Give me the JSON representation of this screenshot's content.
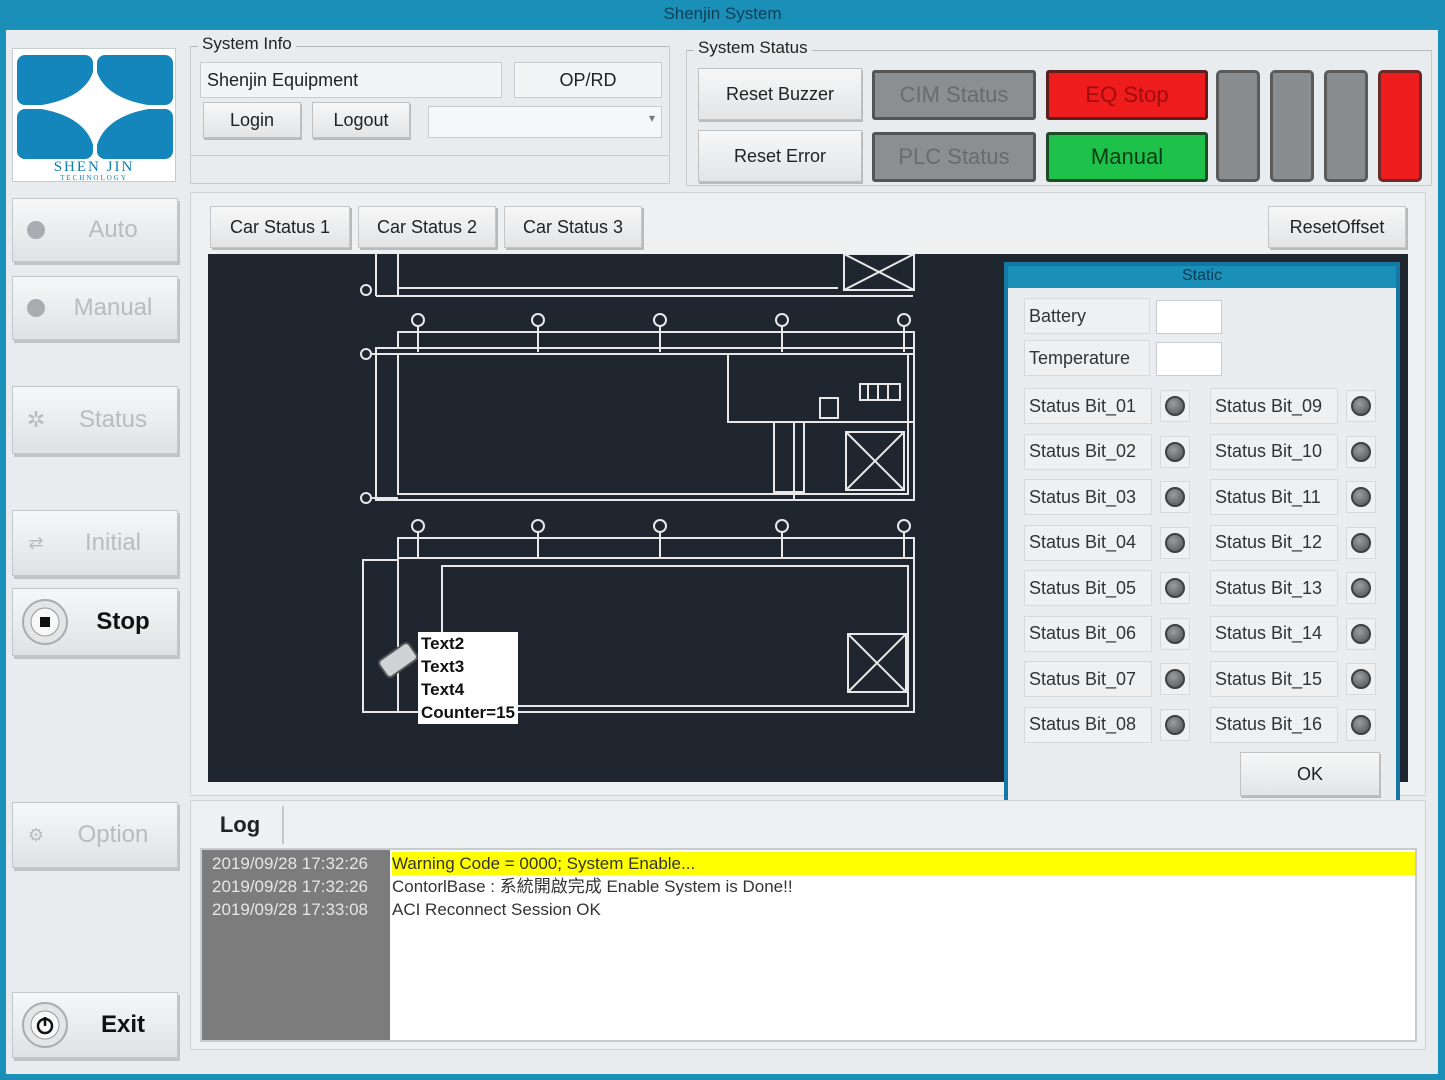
{
  "window": {
    "title": "Shenjin System"
  },
  "logo": {
    "name_line1": "SHEN JIN",
    "name_line2": "TECHNOLOGY"
  },
  "system_info": {
    "title": "System Info",
    "equipment": "Shenjin Equipment",
    "op_rd": "OP/RD",
    "login": "Login",
    "logout": "Logout",
    "combo_value": ""
  },
  "system_status": {
    "title": "System Status",
    "reset_buzzer": "Reset Buzzer",
    "reset_error": "Reset Error",
    "cim_status": "CIM Status",
    "plc_status": "PLC Status",
    "eq_stop": "EQ Stop",
    "manual": "Manual",
    "colors": {
      "eq_stop": "#ee1c1c",
      "manual": "#1ec24a",
      "lamp_gray": "#8a8d90",
      "lamp_red": "#ee1c1c"
    }
  },
  "nav": {
    "auto": "Auto",
    "manual": "Manual",
    "status": "Status",
    "initial": "Initial",
    "stop": "Stop",
    "option": "Option",
    "exit": "Exit"
  },
  "tabs": {
    "car1": "Car Status 1",
    "car2": "Car Status 2",
    "car3": "Car Status 3",
    "reset_offset": "ResetOffset"
  },
  "map": {
    "labels": [
      "Text2",
      "Text3",
      "Text4",
      "Counter=15"
    ]
  },
  "static_dialog": {
    "title": "Static",
    "battery_label": "Battery",
    "battery_value": "",
    "temperature_label": "Temperature",
    "temperature_value": "",
    "bits_left": [
      "Status Bit_01",
      "Status Bit_02",
      "Status Bit_03",
      "Status Bit_04",
      "Status Bit_05",
      "Status Bit_06",
      "Status Bit_07",
      "Status Bit_08"
    ],
    "bits_right": [
      "Status Bit_09",
      "Status Bit_10",
      "Status Bit_11",
      "Status Bit_12",
      "Status Bit_13",
      "Status Bit_14",
      "Status Bit_15",
      "Status Bit_16"
    ],
    "ok": "OK"
  },
  "log": {
    "tab": "Log",
    "rows": [
      {
        "time": "2019/09/28 17:32:26",
        "message": "Warning Code = 0000; System Enable..."
      },
      {
        "time": "2019/09/28 17:32:26",
        "message": "ContorlBase : 系統開啟完成 Enable System is Done!!"
      },
      {
        "time": "2019/09/28 17:33:08",
        "message": "ACI Reconnect Session OK"
      }
    ]
  }
}
